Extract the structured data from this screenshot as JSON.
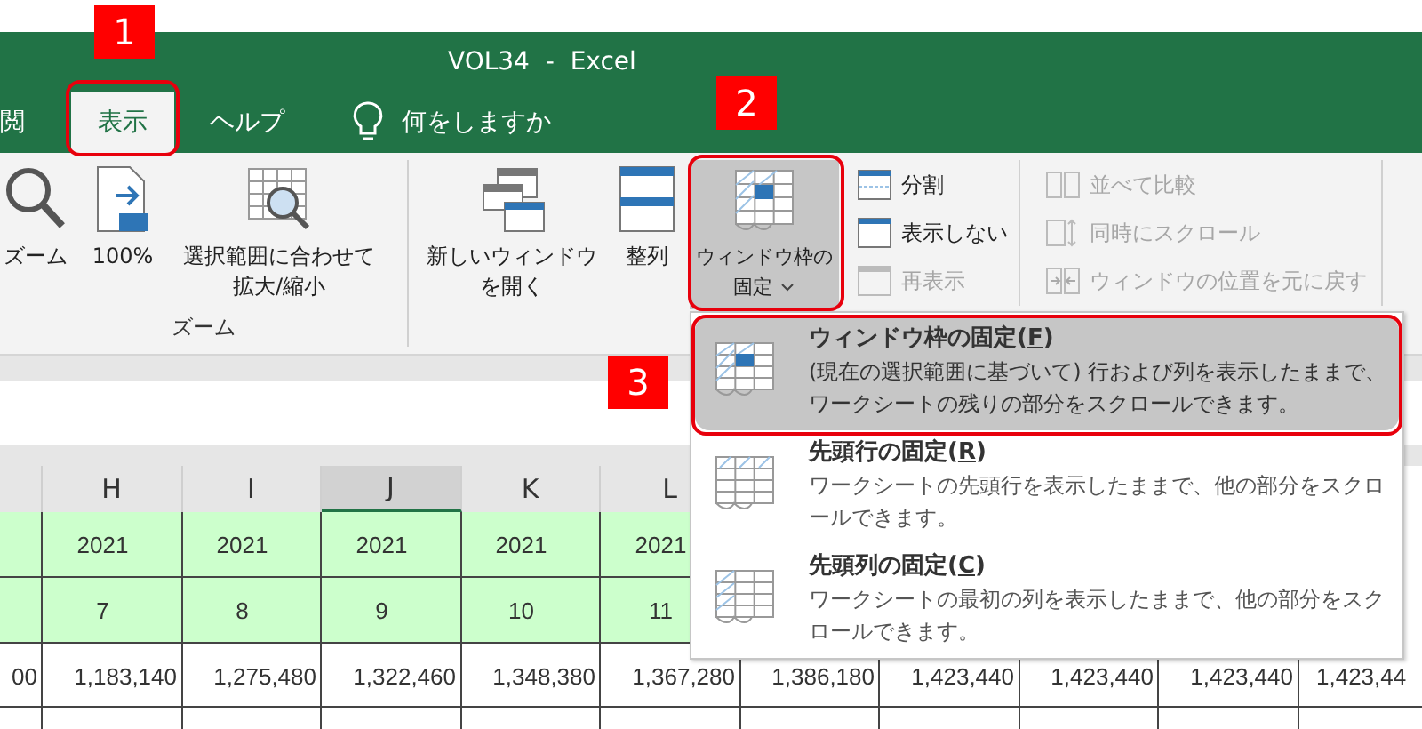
{
  "window": {
    "title": "VOL34  -  Excel"
  },
  "tabs": [
    {
      "label": "閲",
      "selected": false
    },
    {
      "label": "表示",
      "selected": true
    },
    {
      "label": "ヘルプ",
      "selected": false
    }
  ],
  "tell_me": {
    "label": "何をしますか"
  },
  "ribbon": {
    "groups": [
      {
        "label": "ズーム",
        "items": [
          {
            "kind": "large",
            "lines": [
              "ズーム"
            ]
          },
          {
            "kind": "large",
            "lines": [
              "100%"
            ]
          },
          {
            "kind": "large",
            "lines": [
              "選択範囲に合わせて",
              "拡大/縮小"
            ]
          }
        ]
      },
      {
        "items": [
          {
            "kind": "large",
            "lines": [
              "新しいウィンドウ",
              "を開く"
            ]
          },
          {
            "kind": "large",
            "lines": [
              "整列"
            ]
          },
          {
            "kind": "large",
            "lines": [
              "ウィンドウ枠の",
              "固定"
            ],
            "expanded": true
          },
          {
            "kind": "column",
            "buttons": [
              {
                "label": "分割",
                "disabled": false
              },
              {
                "label": "表示しない",
                "disabled": false
              },
              {
                "label": "再表示",
                "disabled": true
              }
            ]
          },
          {
            "kind": "column",
            "buttons": [
              {
                "label": "並べて比較",
                "disabled": true
              },
              {
                "label": "同時にスクロール",
                "disabled": true
              },
              {
                "label": "ウィンドウの位置を元に戻す",
                "disabled": true
              }
            ]
          }
        ]
      }
    ]
  },
  "freeze_menu": [
    {
      "title": "ウィンドウ枠の固定(",
      "key": "F",
      "title_end": ")",
      "description": "(現在の選択範囲に基づいて) 行および列を表示したままで、ワークシートの残りの部分をスクロールできます。",
      "selected": true
    },
    {
      "title": "先頭行の固定(",
      "key": "R",
      "title_end": ")",
      "description": "ワークシートの先頭行を表示したままで、他の部分をスクロールできます。",
      "selected": false
    },
    {
      "title": "先頭列の固定(",
      "key": "C",
      "title_end": ")",
      "description": "ワークシートの最初の列を表示したままで、他の部分をスクロールできます。",
      "selected": false
    }
  ],
  "sheet": {
    "columns": [
      {
        "label": "H",
        "selected": false
      },
      {
        "label": "I",
        "selected": false
      },
      {
        "label": "J",
        "selected": true
      },
      {
        "label": "K",
        "selected": false
      },
      {
        "label": "L",
        "selected": false
      }
    ],
    "rows": [
      {
        "kind": "year",
        "cells": [
          "2021",
          "2021",
          "2021",
          "2021",
          "2021"
        ]
      },
      {
        "kind": "month",
        "cells": [
          "7",
          "8",
          "9",
          "10",
          "11"
        ]
      },
      {
        "kind": "amount",
        "lead": "00",
        "cells": [
          "1,183,140",
          "1,275,480",
          "1,322,460",
          "1,348,380",
          "1,367,280",
          "1,386,180",
          "1,423,440",
          "1,423,440",
          "1,423,440",
          "1,423,44"
        ]
      }
    ]
  },
  "annotations": [
    {
      "label": "1"
    },
    {
      "label": "2"
    },
    {
      "label": "3"
    }
  ]
}
